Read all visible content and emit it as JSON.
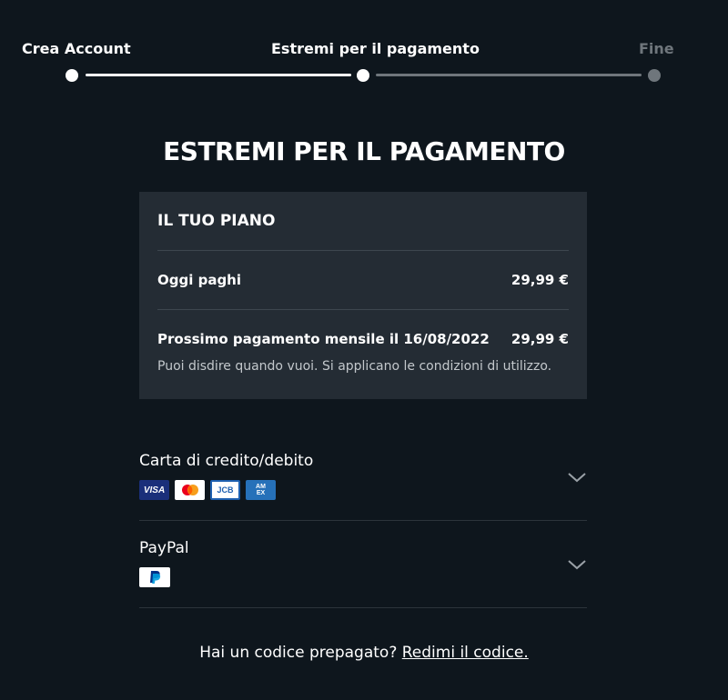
{
  "stepper": {
    "steps": [
      {
        "label": "Crea Account",
        "state": "done"
      },
      {
        "label": "Estremi per il pagamento",
        "state": "current"
      },
      {
        "label": "Fine",
        "state": "todo"
      }
    ]
  },
  "page_title": "ESTREMI PER IL PAGAMENTO",
  "plan": {
    "title": "IL TUO PIANO",
    "today_label": "Oggi paghi",
    "today_amount": "29,99 €",
    "next_label": "Prossimo pagamento mensile il 16/08/2022",
    "next_amount": "29,99 €",
    "note": "Puoi disdire quando vuoi. Si applicano le condizioni di utilizzo."
  },
  "payment_methods": {
    "card": {
      "title": "Carta di credito/debito",
      "logos": {
        "visa": "VISA",
        "mastercard": "mastercard-logo",
        "jcb": "JCB",
        "amex": "AMEX"
      }
    },
    "paypal": {
      "title": "PayPal",
      "logos": {
        "paypal": "paypal-logo"
      }
    }
  },
  "footer": {
    "text": "Hai un codice prepagato?",
    "link": "Redimi il codice."
  },
  "colors": {
    "background": "#0e161d",
    "card": "#242c34",
    "inactive": "#6f767c"
  }
}
